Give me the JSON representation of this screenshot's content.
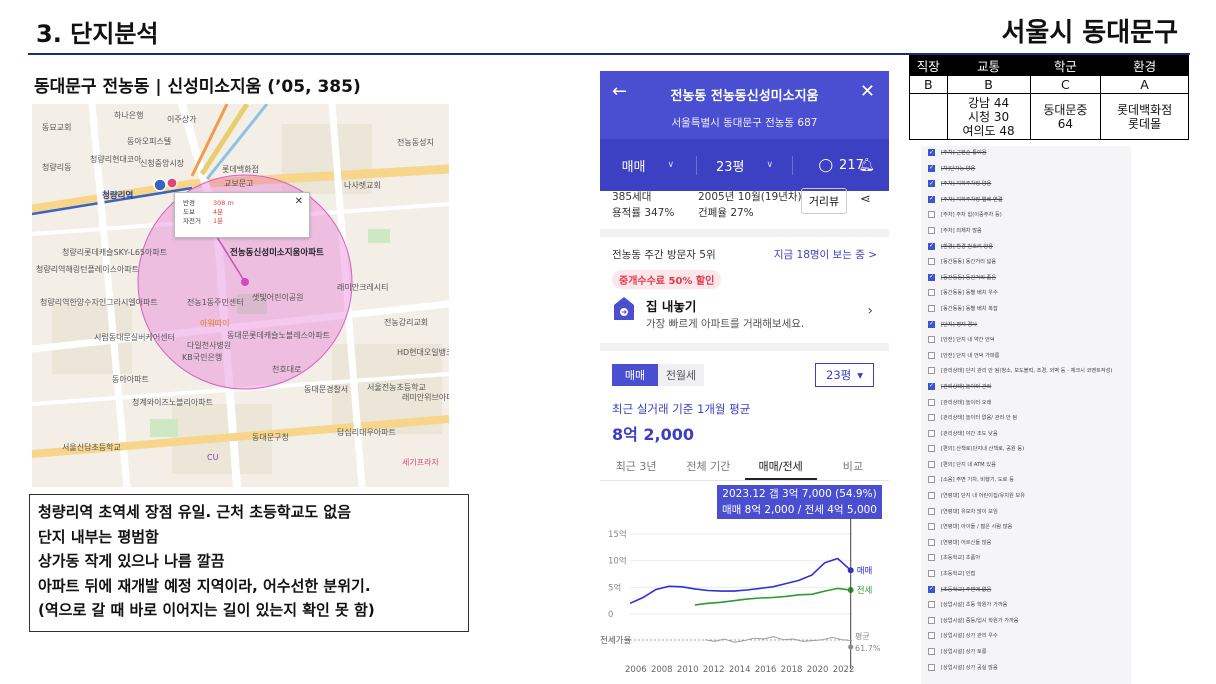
{
  "header": {
    "slide_title": "3. 단지분석",
    "region": "서울시 동대문구"
  },
  "apartment": {
    "title": "동대문구 전농동 | 신성미소지움 (’05, 385)"
  },
  "map": {
    "popup": {
      "rows": [
        {
          "k": "반경",
          "v": "308 m"
        },
        {
          "k": "도보",
          "v": "4분"
        },
        {
          "k": "자전거",
          "v": "1분"
        }
      ]
    },
    "labels": [
      {
        "text": "하나은행",
        "cls": ""
      },
      {
        "text": "이주상가",
        "cls": ""
      },
      {
        "text": "동묘교회",
        "cls": ""
      },
      {
        "text": "동아오피스텔",
        "cls": ""
      },
      {
        "text": "신청중앙시장",
        "cls": ""
      },
      {
        "text": "청량리현대코아",
        "cls": ""
      },
      {
        "text": "청량리역",
        "cls": "main"
      },
      {
        "text": "롯데백화점",
        "cls": ""
      },
      {
        "text": "교보문고",
        "cls": ""
      },
      {
        "text": "청량리동",
        "cls": ""
      },
      {
        "text": "전농동성지",
        "cls": ""
      },
      {
        "text": "청량리롯데캐슬SKY-L65아파트",
        "cls": ""
      },
      {
        "text": "청량리역해링턴플레이스아파트",
        "cls": ""
      },
      {
        "text": "전농1동주민센터",
        "cls": ""
      },
      {
        "text": "전농동신성미소지움아파트",
        "cls": "main"
      },
      {
        "text": "아워따이",
        "cls": ""
      },
      {
        "text": "샛빛어린이공원",
        "cls": ""
      },
      {
        "text": "다일천사병원",
        "cls": ""
      },
      {
        "text": "동대문롯데캐슬노블레스아파트",
        "cls": ""
      },
      {
        "text": "래미안크레시티",
        "cls": ""
      },
      {
        "text": "시립동대문실버케어센터",
        "cls": ""
      },
      {
        "text": "청량리역한양수자인그라시엘아파트",
        "cls": ""
      },
      {
        "text": "KB국민은행",
        "cls": ""
      },
      {
        "text": "동아아파트",
        "cls": ""
      },
      {
        "text": "청계와이즈노블리아파트",
        "cls": ""
      },
      {
        "text": "동대문경찰서",
        "cls": ""
      },
      {
        "text": "서울전농초등학교",
        "cls": ""
      },
      {
        "text": "천호대로",
        "cls": ""
      },
      {
        "text": "세기프라자",
        "cls": ""
      },
      {
        "text": "동대문구청",
        "cls": ""
      },
      {
        "text": "서울신답초등학교",
        "cls": ""
      },
      {
        "text": "답십리대우아파트",
        "cls": ""
      },
      {
        "text": "HD현대오일뱅크",
        "cls": ""
      },
      {
        "text": "래미안위브아파트",
        "cls": ""
      },
      {
        "text": "전농감리교회",
        "cls": ""
      },
      {
        "text": "나사렛교회",
        "cls": ""
      },
      {
        "text": "CU",
        "cls": ""
      }
    ]
  },
  "notes": [
    "청량리역 초역세 장점 유일. 근처 초등학교도 없음",
    "단지 내부는 평범함",
    "상가동 작게 있으나 나름 깔끔",
    "아파트 뒤에 재개발 예정 지역이라, 어수선한 분위기.",
    "(역으로 갈 때 바로 이어지는 길이 있는지 확인 못 함)"
  ],
  "app": {
    "back_icon": "back-arrow-icon",
    "name": "전농동 전농동신성미소지움",
    "address": "서울특별시 동대문구 전농동 687",
    "tabs": {
      "deal": "매매",
      "size": "23평",
      "comments": "217"
    },
    "info": {
      "households": "385세대",
      "far": "용적률 347%",
      "built": "2005년 10월(19년차)",
      "bcr": "건폐율 27%",
      "street_view": "거리뷰"
    },
    "visit": {
      "rank": "전농동 주간 방문자 5위",
      "viewing": "지금 18명이 보는 중 >"
    },
    "promo": "중개수수료 50% 할인",
    "sell": {
      "title": "집 내놓기",
      "desc": "가장 빠르게 아파트를 거래해보세요."
    },
    "segment": {
      "on": "매매",
      "off": "전월세"
    },
    "size_select": "23평",
    "avg": {
      "label": "최근 실거래 기준 1개월 평균",
      "value": "8억 2,000"
    },
    "periods": [
      "최근 3년",
      "전체 기간",
      "매매/전세",
      "비교"
    ],
    "tooltip": {
      "line1": "2023.12  갭 3억 7,000 (54.9%)",
      "line2": "매매 8억 2,000 / 전세 4억 5,000"
    },
    "chart_labels": {
      "ratio_title": "전세가율",
      "ratio_avg": "평균",
      "ratio_value": "61.7%"
    }
  },
  "chart_data": {
    "type": "line",
    "title": "",
    "x": [
      2006,
      2007,
      2008,
      2009,
      2010,
      2011,
      2012,
      2013,
      2014,
      2015,
      2016,
      2017,
      2018,
      2019,
      2020,
      2021,
      2022,
      2023
    ],
    "series": [
      {
        "name": "매매",
        "values": [
          2.0,
          3.1,
          4.6,
          5.2,
          5.1,
          4.7,
          4.4,
          4.3,
          4.3,
          4.5,
          4.8,
          5.1,
          5.7,
          6.3,
          7.3,
          9.6,
          10.4,
          8.2
        ]
      },
      {
        "name": "전세",
        "values": [
          null,
          null,
          null,
          null,
          null,
          1.7,
          2.0,
          2.2,
          2.5,
          2.8,
          3.0,
          3.1,
          3.3,
          3.6,
          3.7,
          4.3,
          4.8,
          4.5
        ]
      }
    ],
    "xlabel": "",
    "ylabel": "",
    "y_ticks": [
      "15억",
      "10억",
      "5억",
      "0"
    ],
    "x_ticks": [
      "2006",
      "2008",
      "2010",
      "2012",
      "2014",
      "2016",
      "2018",
      "2020",
      "2022"
    ],
    "ylim": [
      0,
      15
    ],
    "ratio_series": {
      "name": "전세가율",
      "average": "61.7%"
    }
  },
  "scores": {
    "headers": [
      "직장",
      "교통",
      "학군",
      "환경"
    ],
    "grades": [
      "B",
      "B",
      "C",
      "A"
    ],
    "details": [
      [],
      [
        "강남 44",
        "시청 30",
        "여의도 48"
      ],
      [
        "동대문중",
        "64"
      ],
      [
        "롯데백화점",
        "롯데몰"
      ]
    ]
  },
  "checklist": [
    {
      "text": "[주차] 근본순 통이용",
      "on": true
    },
    {
      "text": "[차]단가능 양용",
      "on": true
    },
    {
      "text": "[주차] 지하주차장 양용",
      "on": true
    },
    {
      "text": "[주차] 지하주차장 엘베 연결",
      "on": true
    },
    {
      "text": "[주차] 주차 힘(이중주차 등)",
      "on": false
    },
    {
      "text": "[주차] 외제차 많음",
      "on": false
    },
    {
      "text": "[환경] 환경 번호키 양용",
      "on": true
    },
    {
      "text": "[동간동동] 동간거리 넓음",
      "on": false
    },
    {
      "text": "[동간동동] 동간거리 좁음",
      "on": true
    },
    {
      "text": "[동간동동] 동별 배치 우수",
      "on": false
    },
    {
      "text": "[동간동동] 동별 배치 복잡",
      "on": false
    },
    {
      "text": "[단지] 평지 경사",
      "on": true
    },
    {
      "text": "[안전] 단지 내 약간 언덕",
      "on": false
    },
    {
      "text": "[안전] 단지 내 언덕 가파름",
      "on": false
    },
    {
      "text": "[관리상태] 단지 관리 안 됨(청소, 보도블럭, 조경, 외벽 등 - 체크시 코멘트작성)",
      "on": false
    },
    {
      "text": "[관리상태] 놀이터 관리",
      "on": true
    },
    {
      "text": "[관리상태] 놀이터 오래",
      "on": false
    },
    {
      "text": "[관리상태] 놀이터 없음/ 관리 안 됨",
      "on": false
    },
    {
      "text": "[관리상태] 야간 조도 낮음",
      "on": false
    },
    {
      "text": "[편의] 산책로(단지내 산책로, 공원 등)",
      "on": false
    },
    {
      "text": "[편의] 단지 내 ATM 있음",
      "on": false
    },
    {
      "text": "[소음] 주변 기차, 비행기, 도로 등",
      "on": false
    },
    {
      "text": "[연령대] 단지 내 어린이집/유치원 보유",
      "on": false
    },
    {
      "text": "[연령대] 유모차 많이 보임",
      "on": false
    },
    {
      "text": "[연령대] 아이들 / 젊은 사람 많음",
      "on": false
    },
    {
      "text": "[연령대] 어르신들 많음",
      "on": false
    },
    {
      "text": "[초등학교] 초품아",
      "on": false
    },
    {
      "text": "[초등학교] 인접",
      "on": false
    },
    {
      "text": "[초등학교] 주변에 없음",
      "on": true
    },
    {
      "text": "[상업시설] 초등 학원가 가까움",
      "on": false
    },
    {
      "text": "[상업시설] 중등/입시 학원가 가까움",
      "on": false
    },
    {
      "text": "[상업시설] 상가 관리 우수",
      "on": false
    },
    {
      "text": "[상업시설] 상가 토롱",
      "on": false
    },
    {
      "text": "[상업시설] 상가 공실 많음",
      "on": false
    }
  ]
}
